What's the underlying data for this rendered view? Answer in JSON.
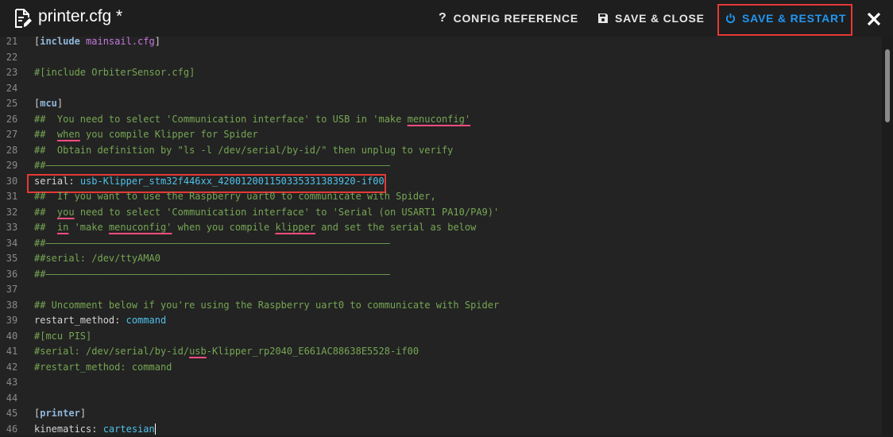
{
  "header": {
    "title": "printer.cfg *",
    "config_reference_label": "CONFIG REFERENCE",
    "save_close_label": "SAVE & CLOSE",
    "save_restart_label": "SAVE & RESTART"
  },
  "editor": {
    "lines": [
      {
        "n": "21",
        "parts": [
          [
            "bracket",
            "["
          ],
          [
            "section",
            "include"
          ],
          [
            "str",
            " mainsail.cfg"
          ],
          [
            "bracket",
            "]"
          ]
        ]
      },
      {
        "n": "22",
        "parts": []
      },
      {
        "n": "23",
        "parts": [
          [
            "comment",
            "#[include OrbiterSensor.cfg]"
          ]
        ]
      },
      {
        "n": "24",
        "parts": []
      },
      {
        "n": "25",
        "parts": [
          [
            "bracket",
            "["
          ],
          [
            "section",
            "mcu"
          ],
          [
            "bracket",
            "]"
          ]
        ]
      },
      {
        "n": "26",
        "parts": [
          [
            "comment",
            "##  You need to select 'Communication interface' to USB in 'make "
          ],
          [
            "commentsp",
            "menuconfig'"
          ]
        ]
      },
      {
        "n": "27",
        "parts": [
          [
            "comment",
            "##  "
          ],
          [
            "commentsp",
            "when"
          ],
          [
            "comment",
            " you compile Klipper for Spider"
          ]
        ]
      },
      {
        "n": "28",
        "parts": [
          [
            "comment",
            "##  Obtain definition by \"ls -l /dev/serial/by-id/\" then unplug to verify"
          ]
        ]
      },
      {
        "n": "29",
        "parts": [
          [
            "comment",
            "##————————————————————————————————————————————————————————————"
          ]
        ]
      },
      {
        "n": "30",
        "parts": [
          [
            "key",
            "serial"
          ],
          [
            "key",
            ": "
          ],
          [
            "val",
            "usb-Klipper_stm32f446xx_4200120011503353313839 20-if00"
          ]
        ]
      },
      {
        "n": "31",
        "parts": [
          [
            "comment",
            "##  If you want to use the Raspberry uart0 to communicate with Spider,"
          ]
        ]
      },
      {
        "n": "32",
        "parts": [
          [
            "comment",
            "##  "
          ],
          [
            "commentsp",
            "you"
          ],
          [
            "comment",
            " need to select 'Communication interface' to 'Serial (on USART1 PA10/PA9)'"
          ]
        ]
      },
      {
        "n": "33",
        "parts": [
          [
            "comment",
            "##  "
          ],
          [
            "commentsp",
            "in"
          ],
          [
            "comment",
            " 'make "
          ],
          [
            "commentsp",
            "menuconfig'"
          ],
          [
            "comment",
            " when you compile "
          ],
          [
            "commentsp",
            "klipper"
          ],
          [
            "comment",
            " and set the serial as below"
          ]
        ]
      },
      {
        "n": "34",
        "parts": [
          [
            "comment",
            "##————————————————————————————————————————————————————————————"
          ]
        ]
      },
      {
        "n": "35",
        "parts": [
          [
            "comment",
            "##serial: /dev/ttyAMA0"
          ]
        ]
      },
      {
        "n": "36",
        "parts": [
          [
            "comment",
            "##————————————————————————————————————————————————————————————"
          ]
        ]
      },
      {
        "n": "37",
        "parts": []
      },
      {
        "n": "38",
        "parts": [
          [
            "comment",
            "## Uncomment below if you're using the Raspberry uart0 to communicate with Spider"
          ]
        ]
      },
      {
        "n": "39",
        "parts": [
          [
            "key",
            "restart_method"
          ],
          [
            "key",
            ": "
          ],
          [
            "val",
            "command"
          ]
        ]
      },
      {
        "n": "40",
        "parts": [
          [
            "comment",
            "#[mcu PIS]"
          ]
        ]
      },
      {
        "n": "41",
        "parts": [
          [
            "comment",
            "#serial: /dev/serial/by-id/"
          ],
          [
            "commentsp",
            "usb"
          ],
          [
            "comment",
            "-Klipper_rp2040_E661AC88638E5528-if00"
          ]
        ]
      },
      {
        "n": "42",
        "parts": [
          [
            "comment",
            "#restart_method: command"
          ]
        ]
      },
      {
        "n": "43",
        "parts": []
      },
      {
        "n": "44",
        "parts": []
      },
      {
        "n": "45",
        "parts": [
          [
            "bracket",
            "["
          ],
          [
            "section",
            "printer"
          ],
          [
            "bracket",
            "]"
          ]
        ]
      },
      {
        "n": "46",
        "parts": [
          [
            "key",
            "kinematics"
          ],
          [
            "key",
            ": "
          ],
          [
            "val",
            "cartesian"
          ]
        ]
      }
    ]
  }
}
